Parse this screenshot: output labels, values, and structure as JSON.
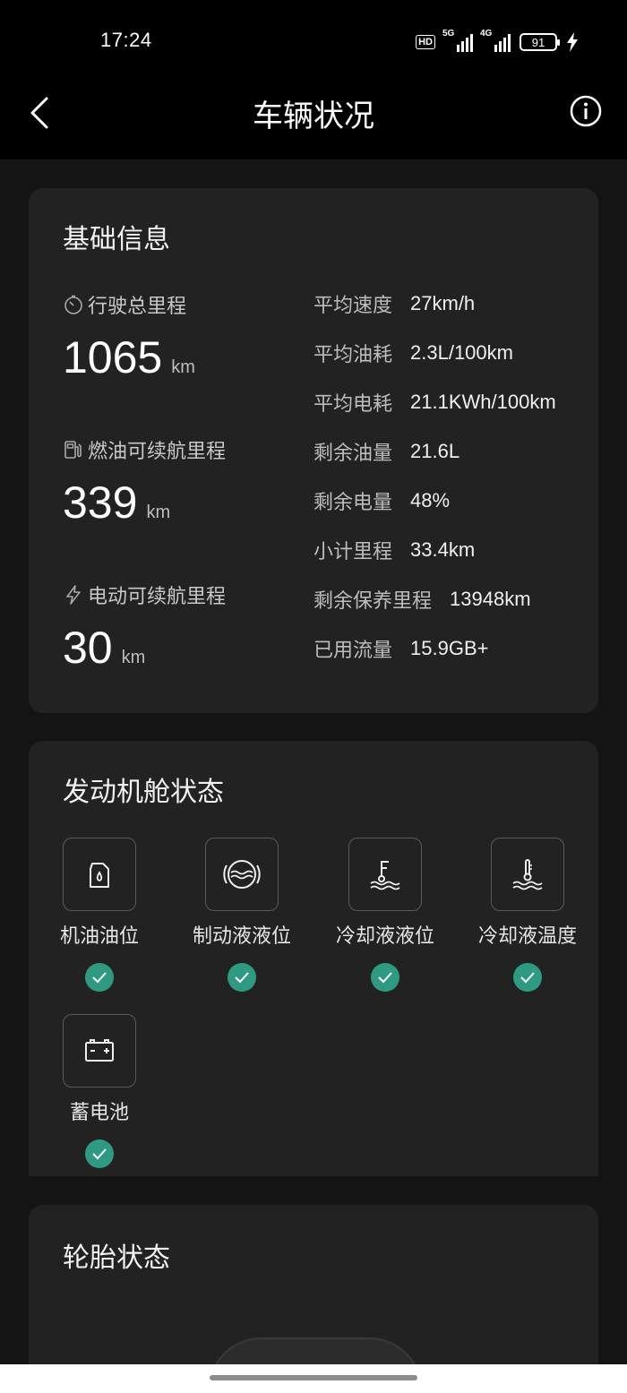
{
  "status_bar": {
    "time": "17:24",
    "hd_label": "HD",
    "net1_label": "5G",
    "net2_label": "4G",
    "battery_level": "91"
  },
  "header": {
    "title": "车辆状况"
  },
  "basic_info": {
    "title": "基础信息",
    "total_mileage": {
      "label": "行驶总里程",
      "value": "1065",
      "unit": "km"
    },
    "fuel_range": {
      "label": "燃油可续航里程",
      "value": "339",
      "unit": "km"
    },
    "electric_range": {
      "label": "电动可续航里程",
      "value": "30",
      "unit": "km"
    },
    "stats": [
      {
        "key": "平均速度",
        "value": "27km/h"
      },
      {
        "key": "平均油耗",
        "value": "2.3L/100km"
      },
      {
        "key": "平均电耗",
        "value": "21.1KWh/100km"
      },
      {
        "key": "剩余油量",
        "value": "21.6L"
      },
      {
        "key": "剩余电量",
        "value": "48%"
      },
      {
        "key": "小计里程",
        "value": "33.4km"
      },
      {
        "key": "剩余保养里程",
        "value": "13948km"
      },
      {
        "key": "已用流量",
        "value": "15.9GB+"
      }
    ]
  },
  "engine": {
    "title": "发动机舱状态",
    "items": [
      {
        "label": "机油油位",
        "icon": "oil-can-icon",
        "status": "ok"
      },
      {
        "label": "制动液液位",
        "icon": "brake-fluid-icon",
        "status": "ok"
      },
      {
        "label": "冷却液液位",
        "icon": "coolant-level-icon",
        "status": "ok"
      },
      {
        "label": "冷却液温度",
        "icon": "coolant-temperature-icon",
        "status": "ok"
      },
      {
        "label": "蓄电池",
        "icon": "battery-icon",
        "status": "ok"
      }
    ],
    "check_color": "#2f9a82"
  },
  "tires": {
    "title": "轮胎状态"
  }
}
